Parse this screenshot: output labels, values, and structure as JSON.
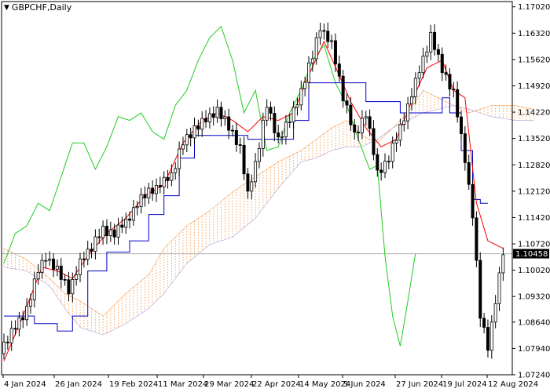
{
  "chart_data": {
    "type": "candlestick",
    "title": "GBPCHF,Daily",
    "symbol": "GBPCHF",
    "timeframe": "Daily",
    "indicator": "Ichimoku Kinko Hyo",
    "current_price": "1.10458",
    "y_ticks": [
      "1.17020",
      "1.16320",
      "1.15620",
      "1.14920",
      "1.14220",
      "1.13520",
      "1.12820",
      "1.12120",
      "1.11420",
      "1.10720",
      "1.10020",
      "1.09320",
      "1.08640",
      "1.07940",
      "1.07240"
    ],
    "x_ticks": [
      "4 Jan 2024",
      "26 Jan 2024",
      "19 Feb 2024",
      "11 Mar 2024",
      "29 Mar 2024",
      "22 Apr 2024",
      "14 May 2024",
      "5 Jun 2024",
      "27 Jun 2024",
      "19 Jul 2024",
      "12 Aug 2024"
    ],
    "ylim": [
      1.0724,
      1.1716
    ],
    "close_anchors": [
      [
        0,
        1.08
      ],
      [
        3,
        1.085
      ],
      [
        6,
        1.09
      ],
      [
        9,
        1.1
      ],
      [
        11,
        1.104
      ],
      [
        14,
        1.1
      ],
      [
        17,
        1.095
      ],
      [
        20,
        1.102
      ],
      [
        23,
        1.106
      ],
      [
        26,
        1.111
      ],
      [
        29,
        1.11
      ],
      [
        32,
        1.113
      ],
      [
        35,
        1.118
      ],
      [
        38,
        1.121
      ],
      [
        41,
        1.123
      ],
      [
        44,
        1.125
      ],
      [
        47,
        1.134
      ],
      [
        50,
        1.138
      ],
      [
        53,
        1.14
      ],
      [
        56,
        1.143
      ],
      [
        59,
        1.138
      ],
      [
        62,
        1.133
      ],
      [
        64,
        1.12
      ],
      [
        66,
        1.128
      ],
      [
        69,
        1.144
      ],
      [
        72,
        1.135
      ],
      [
        75,
        1.14
      ],
      [
        78,
        1.148
      ],
      [
        81,
        1.157
      ],
      [
        83,
        1.165
      ],
      [
        86,
        1.16
      ],
      [
        89,
        1.146
      ],
      [
        92,
        1.136
      ],
      [
        95,
        1.142
      ],
      [
        98,
        1.126
      ],
      [
        101,
        1.13
      ],
      [
        104,
        1.138
      ],
      [
        107,
        1.147
      ],
      [
        110,
        1.156
      ],
      [
        112,
        1.162
      ],
      [
        115,
        1.154
      ],
      [
        118,
        1.147
      ],
      [
        121,
        1.13
      ],
      [
        123,
        1.115
      ],
      [
        125,
        1.088
      ],
      [
        127,
        1.08
      ],
      [
        129,
        1.092
      ],
      [
        131,
        1.1046
      ]
    ],
    "candle_noise": [
      0.0011,
      -0.0008,
      0.0014,
      -0.0005,
      0.0009,
      -0.0013,
      0.0006,
      -0.001,
      0.0012,
      -0.0004,
      0.0008,
      -0.0012,
      0.0005,
      -0.0009,
      0.0013,
      -0.0006,
      0.001,
      -0.0011,
      0.0004,
      -0.0007,
      0.0012,
      -0.0003
    ],
    "tenkan_anchors": [
      [
        0,
        1.076
      ],
      [
        5,
        1.088
      ],
      [
        10,
        1.101
      ],
      [
        14,
        1.1
      ],
      [
        18,
        1.098
      ],
      [
        22,
        1.104
      ],
      [
        27,
        1.11
      ],
      [
        32,
        1.114
      ],
      [
        37,
        1.12
      ],
      [
        42,
        1.123
      ],
      [
        47,
        1.134
      ],
      [
        52,
        1.14
      ],
      [
        56,
        1.142
      ],
      [
        60,
        1.14
      ],
      [
        64,
        1.137
      ],
      [
        68,
        1.141
      ],
      [
        72,
        1.14
      ],
      [
        76,
        1.142
      ],
      [
        80,
        1.152
      ],
      [
        84,
        1.161
      ],
      [
        88,
        1.152
      ],
      [
        91,
        1.145
      ],
      [
        95,
        1.138
      ],
      [
        99,
        1.133
      ],
      [
        103,
        1.135
      ],
      [
        107,
        1.145
      ],
      [
        111,
        1.154
      ],
      [
        115,
        1.156
      ],
      [
        118,
        1.148
      ],
      [
        121,
        1.146
      ],
      [
        124,
        1.118
      ],
      [
        127,
        1.108
      ],
      [
        131,
        1.106
      ]
    ],
    "kijun_anchors": [
      [
        0,
        1.088
      ],
      [
        8,
        1.086
      ],
      [
        14,
        1.084
      ],
      [
        18,
        1.088
      ],
      [
        22,
        1.1
      ],
      [
        27,
        1.105
      ],
      [
        33,
        1.108
      ],
      [
        38,
        1.115
      ],
      [
        42,
        1.12
      ],
      [
        46,
        1.13
      ],
      [
        50,
        1.136
      ],
      [
        55,
        1.136
      ],
      [
        60,
        1.136
      ],
      [
        64,
        1.135
      ],
      [
        70,
        1.135
      ],
      [
        76,
        1.14
      ],
      [
        80,
        1.15
      ],
      [
        86,
        1.15
      ],
      [
        91,
        1.15
      ],
      [
        95,
        1.145
      ],
      [
        100,
        1.145
      ],
      [
        104,
        1.142
      ],
      [
        108,
        1.142
      ],
      [
        112,
        1.142
      ],
      [
        115,
        1.146
      ],
      [
        117,
        1.142
      ],
      [
        120,
        1.132
      ],
      [
        123,
        1.119
      ],
      [
        125,
        1.118
      ],
      [
        127,
        1.118
      ]
    ],
    "chikou_anchors": [
      [
        0,
        1.102
      ],
      [
        3,
        1.11
      ],
      [
        6,
        1.112
      ],
      [
        9,
        1.118
      ],
      [
        12,
        1.116
      ],
      [
        15,
        1.125
      ],
      [
        18,
        1.134
      ],
      [
        21,
        1.134
      ],
      [
        24,
        1.127
      ],
      [
        27,
        1.133
      ],
      [
        30,
        1.141
      ],
      [
        33,
        1.14
      ],
      [
        36,
        1.142
      ],
      [
        39,
        1.137
      ],
      [
        42,
        1.135
      ],
      [
        45,
        1.144
      ],
      [
        48,
        1.148
      ],
      [
        51,
        1.156
      ],
      [
        54,
        1.162
      ],
      [
        57,
        1.165
      ],
      [
        60,
        1.156
      ],
      [
        63,
        1.142
      ],
      [
        66,
        1.148
      ],
      [
        69,
        1.132
      ],
      [
        72,
        1.133
      ],
      [
        75,
        1.142
      ],
      [
        78,
        1.148
      ],
      [
        81,
        1.156
      ],
      [
        84,
        1.16
      ],
      [
        87,
        1.15
      ],
      [
        90,
        1.144
      ],
      [
        93,
        1.135
      ],
      [
        96,
        1.127
      ],
      [
        98,
        1.128
      ],
      [
        100,
        1.104
      ],
      [
        102,
        1.088
      ],
      [
        104,
        1.08
      ],
      [
        106,
        1.092
      ],
      [
        108,
        1.1046
      ]
    ],
    "senkou_a_anchors": [
      [
        0,
        1.106
      ],
      [
        6,
        1.103
      ],
      [
        12,
        1.098
      ],
      [
        16,
        1.094
      ],
      [
        20,
        1.092
      ],
      [
        26,
        1.088
      ],
      [
        32,
        1.094
      ],
      [
        38,
        1.099
      ],
      [
        42,
        1.106
      ],
      [
        48,
        1.112
      ],
      [
        54,
        1.116
      ],
      [
        60,
        1.121
      ],
      [
        66,
        1.125
      ],
      [
        72,
        1.129
      ],
      [
        78,
        1.132
      ],
      [
        82,
        1.135
      ],
      [
        86,
        1.138
      ],
      [
        90,
        1.14
      ],
      [
        94,
        1.136
      ],
      [
        98,
        1.134
      ],
      [
        102,
        1.138
      ],
      [
        106,
        1.142
      ],
      [
        110,
        1.148
      ],
      [
        114,
        1.146
      ],
      [
        118,
        1.144
      ],
      [
        122,
        1.142
      ],
      [
        128,
        1.144
      ],
      [
        134,
        1.144
      ],
      [
        139,
        1.143
      ]
    ],
    "senkou_b_anchors": [
      [
        0,
        1.101
      ],
      [
        6,
        1.1
      ],
      [
        12,
        1.096
      ],
      [
        16,
        1.09
      ],
      [
        20,
        1.085
      ],
      [
        26,
        1.083
      ],
      [
        32,
        1.086
      ],
      [
        38,
        1.09
      ],
      [
        42,
        1.094
      ],
      [
        48,
        1.102
      ],
      [
        54,
        1.107
      ],
      [
        60,
        1.109
      ],
      [
        66,
        1.114
      ],
      [
        72,
        1.122
      ],
      [
        78,
        1.129
      ],
      [
        82,
        1.13
      ],
      [
        86,
        1.132
      ],
      [
        90,
        1.133
      ],
      [
        94,
        1.133
      ],
      [
        98,
        1.135
      ],
      [
        102,
        1.138
      ],
      [
        106,
        1.14
      ],
      [
        110,
        1.142
      ],
      [
        114,
        1.143
      ],
      [
        118,
        1.144
      ],
      [
        122,
        1.143
      ],
      [
        128,
        1.141
      ],
      [
        134,
        1.14
      ],
      [
        139,
        1.14
      ]
    ],
    "colors": {
      "candle": "#000000",
      "tenkan": "#ff0000",
      "kijun": "#0000c8",
      "chikou": "#22cc22",
      "kumo_bull": "#f4a460",
      "kumo_bear": "#b0a0d8",
      "price_line": "#b0b0b0",
      "axis": "#000000"
    }
  }
}
